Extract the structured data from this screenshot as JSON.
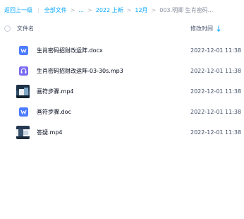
{
  "breadcrumb": {
    "back": "返回上一级",
    "items": [
      "全部文件",
      "...",
      "2022 上新",
      "12月"
    ],
    "current": "003.明卿 生肖密码..."
  },
  "header": {
    "name_col": "文件名",
    "time_col": "修改时间"
  },
  "files": [
    {
      "name": "生肖密码招财改运阵.docx",
      "modified": "2022-12-01 11:38",
      "type": "doc",
      "icon": "word-doc-icon"
    },
    {
      "name": "生肖密码招财改运阵-03-30s.mp3",
      "modified": "2022-12-01 11:38",
      "type": "audio",
      "icon": "audio-file-icon"
    },
    {
      "name": "画符步骤.mp4",
      "modified": "2022-12-01 11:38",
      "type": "video",
      "icon": "video-thumbnail"
    },
    {
      "name": "画符步骤.doc",
      "modified": "2022-12-01 11:38",
      "type": "doc",
      "icon": "word-doc-icon"
    },
    {
      "name": "答疑.mp4",
      "modified": "2022-12-01 11:38",
      "type": "video",
      "icon": "video-thumbnail"
    }
  ],
  "colors": {
    "accent": "#06a7ff",
    "doc_icon": "#4d7cff",
    "audio_icon": "#7b6cf0"
  }
}
